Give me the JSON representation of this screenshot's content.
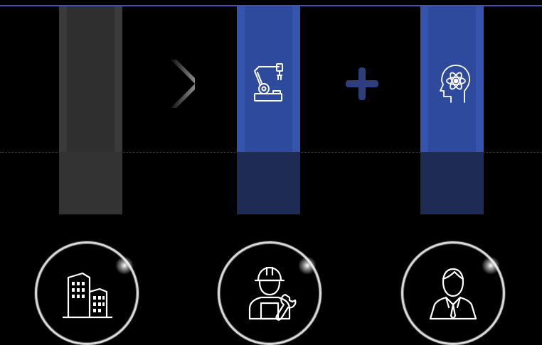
{
  "colors": {
    "background": "#000000",
    "accent_blue": "#3f53b8",
    "column_blue": "#2e4a9c",
    "column_blue_dark": "#1d2b55",
    "column_gray": "#2f2f2f",
    "icon_stroke": "#ffffff"
  },
  "columns": [
    {
      "name": "legacy-column",
      "style": "gray",
      "icon": null
    },
    {
      "name": "robot-arm-column",
      "style": "blue",
      "icon": "robot-arm-icon"
    },
    {
      "name": "ai-brain-column",
      "style": "blue",
      "icon": "ai-head-icon"
    }
  ],
  "connectors": [
    {
      "name": "chevron-right-icon"
    },
    {
      "name": "plus-icon"
    }
  ],
  "circles": [
    {
      "icon": "buildings-icon"
    },
    {
      "icon": "worker-icon"
    },
    {
      "icon": "businessman-icon"
    }
  ]
}
